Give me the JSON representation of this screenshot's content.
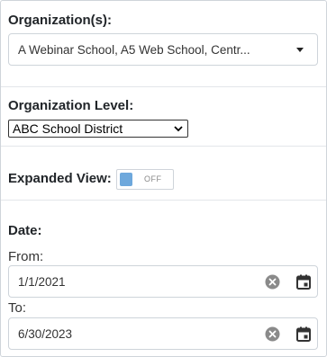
{
  "organizations": {
    "label": "Organization(s):",
    "selected": "A Webinar School, A5 Web School, Centr..."
  },
  "organization_level": {
    "label": "Organization Level:",
    "selected": "ABC School District"
  },
  "expanded_view": {
    "label": "Expanded View:",
    "toggle_text": "OFF",
    "state": "off"
  },
  "date": {
    "label": "Date:",
    "from_label": "From:",
    "from_value": "1/1/2021",
    "to_label": "To:",
    "to_value": "6/30/2023"
  },
  "colors": {
    "toggle_knob": "#6ea8dc",
    "border": "#ced4da",
    "icon": "#8a8a8a"
  }
}
